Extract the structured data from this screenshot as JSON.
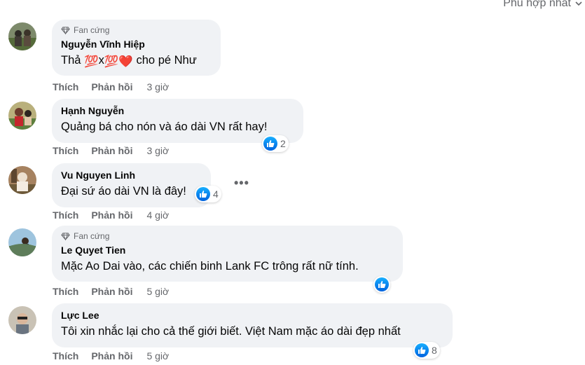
{
  "sort": {
    "label": "Phù hợp nhất"
  },
  "colors": {
    "like": "#1877f2",
    "bubble": "#f0f2f5",
    "meta": "#65676b"
  },
  "actions": {
    "like": "Thích",
    "reply": "Phản hồi"
  },
  "comments": [
    {
      "badge": "Fan cứng",
      "author": "Nguyễn Vĩnh Hiệp",
      "text_before": "Thả ",
      "emoji_1": "💯",
      "mult": "x",
      "emoji_2": "💯",
      "heart": "❤️",
      "text_after": " cho pé Như",
      "time": "3 giờ"
    },
    {
      "author": "Hạnh Nguyễn",
      "text": "Quảng bá cho nón và áo dài VN rất hay!",
      "time": "3 giờ",
      "reactions": "2"
    },
    {
      "author": "Vu Nguyen Linh",
      "text": "Đại sứ áo dài VN là đây!",
      "time": "4 giờ",
      "reactions": "4"
    },
    {
      "badge": "Fan cứng",
      "author": "Le Quyet Tien",
      "text": "Mặc Ao Dai vào, các chiến binh Lank FC trông rất nữ tính.",
      "time": "5 giờ"
    },
    {
      "author": "Lực Lee",
      "text": "Tôi xin nhắc lại cho cả thế giới biết. Việt Nam mặc áo dài đẹp nhất",
      "time": "5 giờ",
      "reactions": "8"
    }
  ]
}
